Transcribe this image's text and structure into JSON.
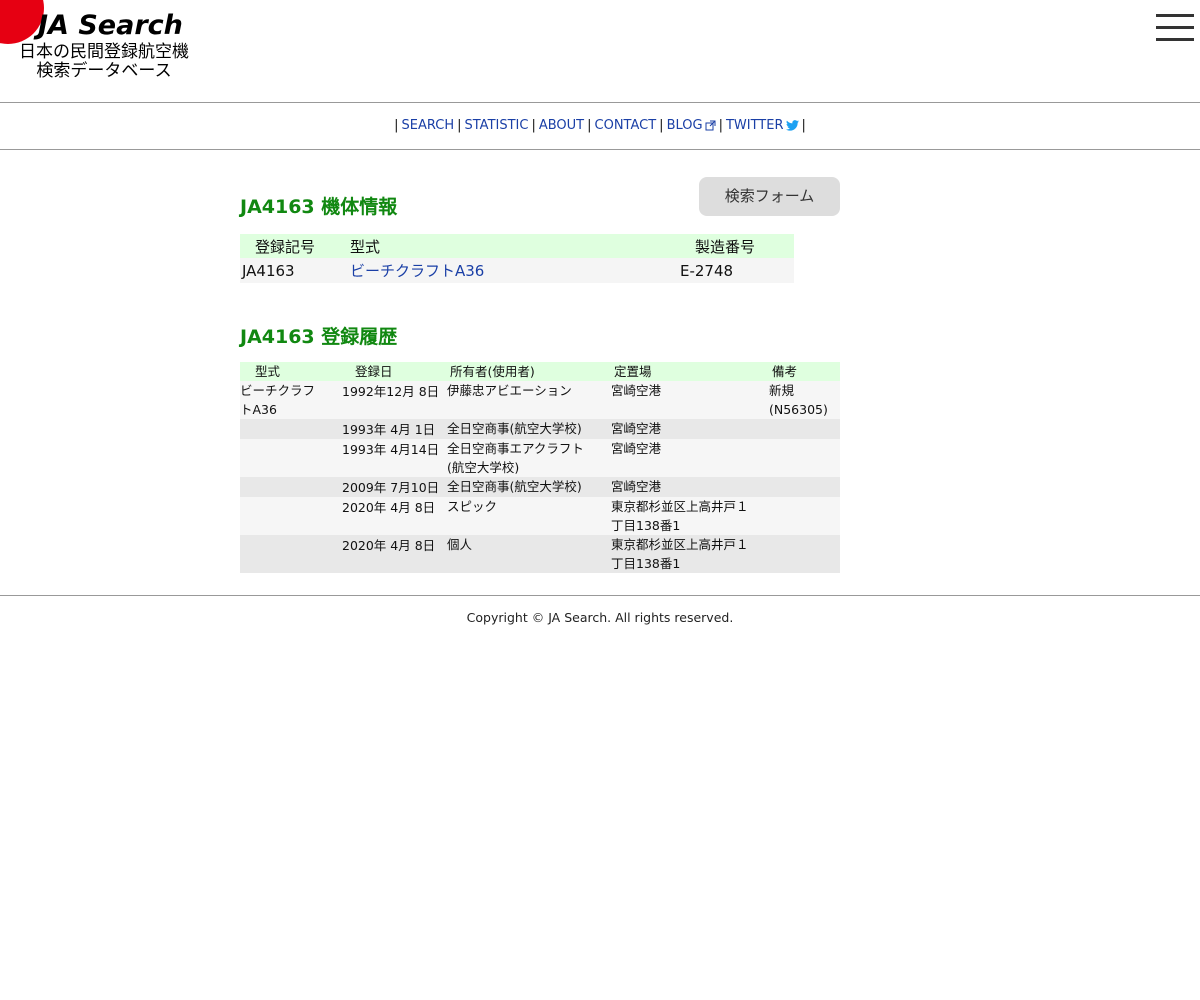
{
  "header": {
    "logo_title": "JA Search",
    "logo_sub_line1": "日本の民間登録航空機",
    "logo_sub_line2": "検索データベース",
    "brand_color": "#e60012"
  },
  "nav": {
    "items": [
      {
        "label": "SEARCH"
      },
      {
        "label": "STATISTIC"
      },
      {
        "label": "ABOUT"
      },
      {
        "label": "CONTACT"
      },
      {
        "label": "BLOG"
      },
      {
        "label": "TWITTER"
      }
    ],
    "link_color": "#1a3fa6"
  },
  "aircraft_info": {
    "title": "JA4163 機体情報",
    "search_button": "検索フォーム",
    "headers": [
      "登録記号",
      "型式",
      "製造番号"
    ],
    "row": {
      "registration": "JA4163",
      "model": "ビーチクラフトA36",
      "serial": "E-2748"
    }
  },
  "history": {
    "title": "JA4163 登録履歴",
    "headers": [
      "型式",
      "登録日",
      "所有者(使用者)",
      "定置場",
      "備考"
    ],
    "rows": [
      {
        "model_line1": "ビーチクラフ",
        "model_line2": "トA36",
        "date": "1992年12月 8日",
        "owner_line1": "伊藤忠アビエーション",
        "owner_line2": "",
        "base_line1": "宮崎空港",
        "base_line2": "",
        "note_line1": "新規",
        "note_line2": "(N56305)"
      },
      {
        "model_line1": "",
        "model_line2": "",
        "date": "1993年 4月 1日",
        "owner_line1": "全日空商事(航空大学校)",
        "owner_line2": "",
        "base_line1": "宮崎空港",
        "base_line2": "",
        "note_line1": "",
        "note_line2": ""
      },
      {
        "model_line1": "",
        "model_line2": "",
        "date": "1993年 4月14日",
        "owner_line1": "全日空商事エアクラフト",
        "owner_line2": "(航空大学校)",
        "base_line1": "宮崎空港",
        "base_line2": "",
        "note_line1": "",
        "note_line2": ""
      },
      {
        "model_line1": "",
        "model_line2": "",
        "date": "2009年 7月10日",
        "owner_line1": "全日空商事(航空大学校)",
        "owner_line2": "",
        "base_line1": "宮崎空港",
        "base_line2": "",
        "note_line1": "",
        "note_line2": ""
      },
      {
        "model_line1": "",
        "model_line2": "",
        "date": "2020年 4月 8日",
        "owner_line1": "スピック",
        "owner_line2": "",
        "base_line1": "東京都杉並区上高井戸１",
        "base_line2": "丁目138番1",
        "note_line1": "",
        "note_line2": ""
      },
      {
        "model_line1": "",
        "model_line2": "",
        "date": "2020年 4月 8日",
        "owner_line1": "個人",
        "owner_line2": "",
        "base_line1": "東京都杉並区上高井戸１",
        "base_line2": "丁目138番1",
        "note_line1": "",
        "note_line2": ""
      }
    ]
  },
  "footer": {
    "copyright": "Copyright © JA Search. All rights reserved."
  }
}
